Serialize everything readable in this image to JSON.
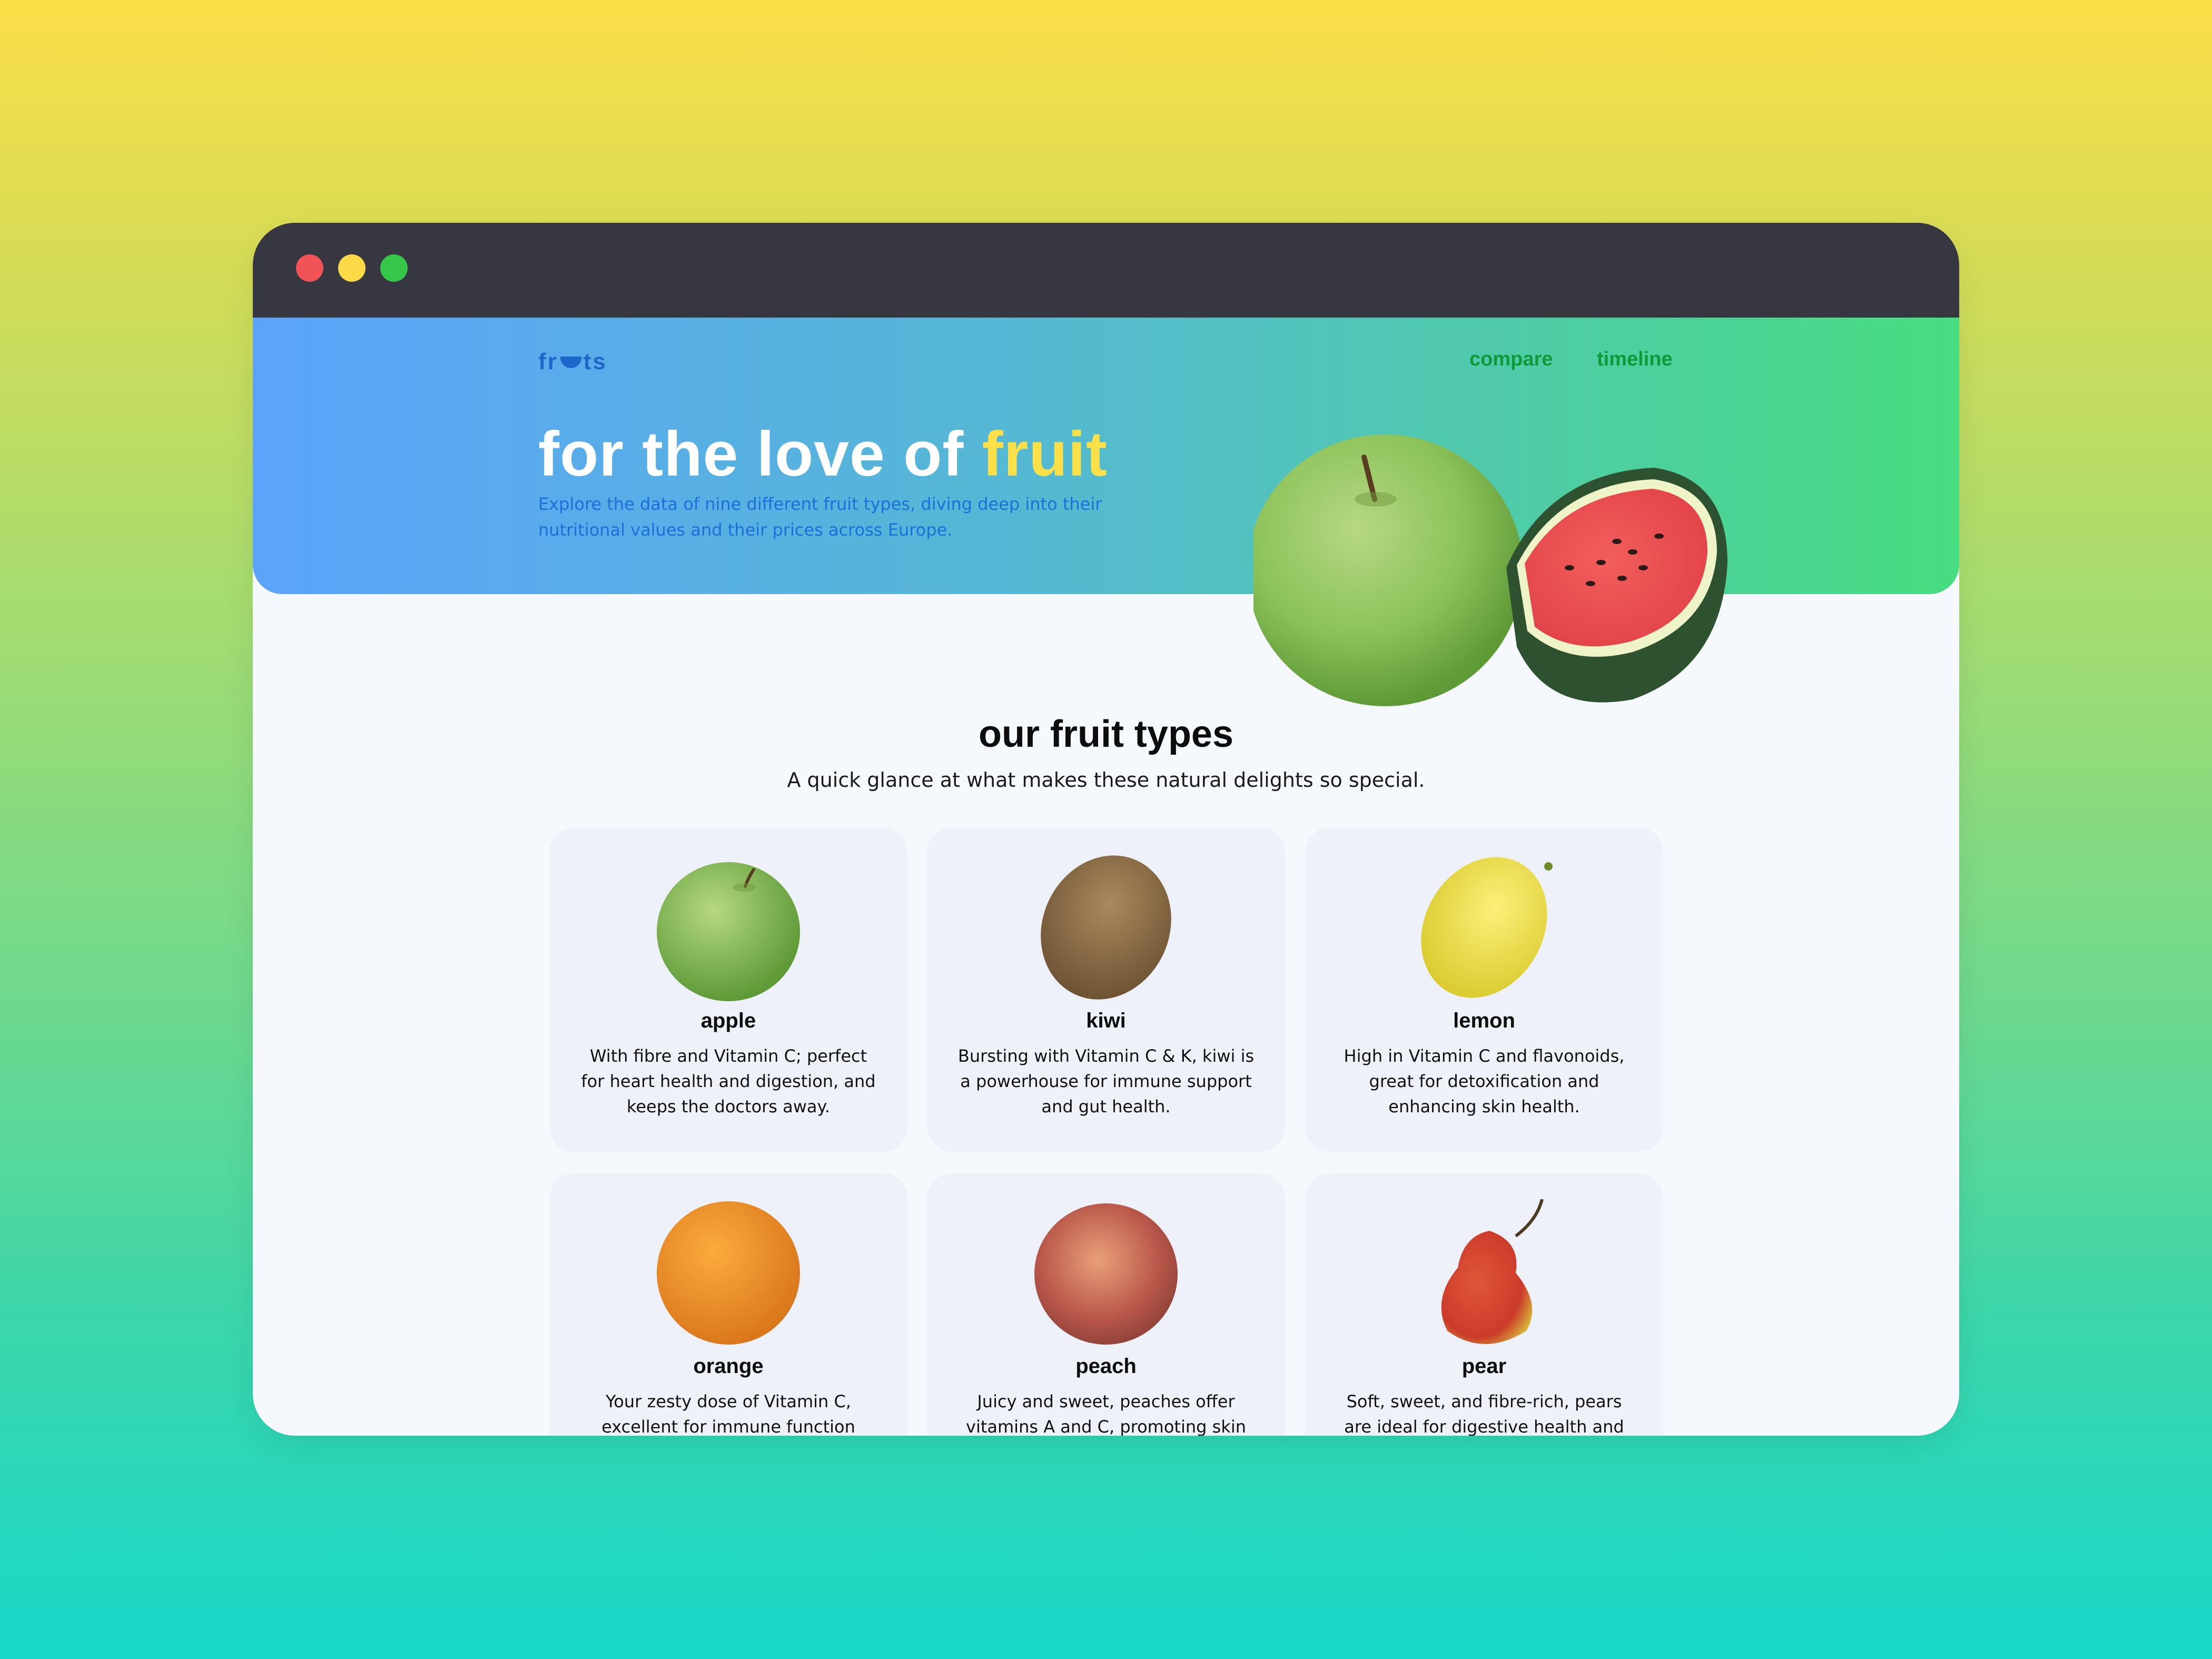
{
  "logo": {
    "text_left": "fr",
    "text_right": "ts"
  },
  "nav": {
    "compare": "compare",
    "timeline": "timeline"
  },
  "hero": {
    "title_main": "for the love of ",
    "title_accent": "fruit",
    "subtitle": "Explore the data of nine different fruit types, diving deep into their nutritional values and their prices across Europe."
  },
  "section": {
    "title": "our fruit types",
    "subtitle": "A quick glance at what makes these natural delights so special."
  },
  "fruits": [
    {
      "name": "apple",
      "description": "With fibre and Vitamin C; perfect for heart health and digestion, and keeps the doctors away."
    },
    {
      "name": "kiwi",
      "description": "Bursting with Vitamin C & K, kiwi is a powerhouse for immune support and gut health."
    },
    {
      "name": "lemon",
      "description": "High in Vitamin C and flavonoids, great for detoxification and enhancing skin health."
    },
    {
      "name": "orange",
      "description": "Your zesty dose of Vitamin C, excellent for immune function"
    },
    {
      "name": "peach",
      "description": "Juicy and sweet, peaches offer vitamins A and C, promoting skin"
    },
    {
      "name": "pear",
      "description": "Soft, sweet, and fibre-rich, pears are ideal for digestive health and"
    }
  ],
  "colors": {
    "accent_yellow": "#fbe04a",
    "nav_green": "#0f9a39",
    "logo_blue": "#1f66c9",
    "titlebar": "#373740"
  }
}
